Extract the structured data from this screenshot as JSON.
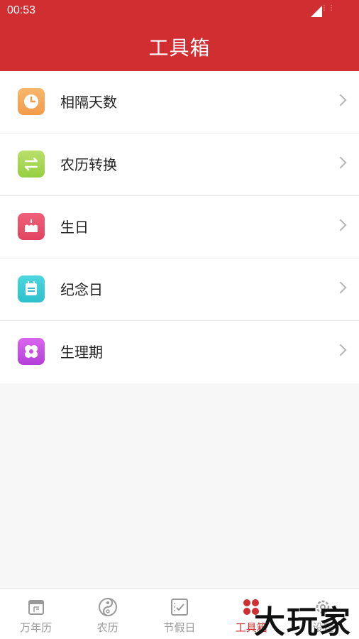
{
  "status_bar": {
    "time": "00:53"
  },
  "header": {
    "title": "工具箱"
  },
  "tools": [
    {
      "label": "相隔天数",
      "icon": "clock-icon",
      "color": "#f4a55a"
    },
    {
      "label": "农历转换",
      "icon": "swap-arrows-icon",
      "color": "#a8d653"
    },
    {
      "label": "生日",
      "icon": "cake-icon",
      "color": "#e8506b"
    },
    {
      "label": "纪念日",
      "icon": "notepad-icon",
      "color": "#3ccbd6"
    },
    {
      "label": "生理期",
      "icon": "flower-icon",
      "color": "#c652e2"
    }
  ],
  "tabs": [
    {
      "label": "万年历",
      "icon": "calendar-icon",
      "active": false
    },
    {
      "label": "农历",
      "icon": "yinyang-icon",
      "active": false
    },
    {
      "label": "节假日",
      "icon": "checklist-icon",
      "active": false
    },
    {
      "label": "工具箱",
      "icon": "toolbox-icon",
      "active": true
    },
    {
      "label": "设置",
      "icon": "settings-icon",
      "active": false
    }
  ],
  "watermark": {
    "text": "大玩家"
  },
  "colors": {
    "brand": "#d12e31"
  }
}
